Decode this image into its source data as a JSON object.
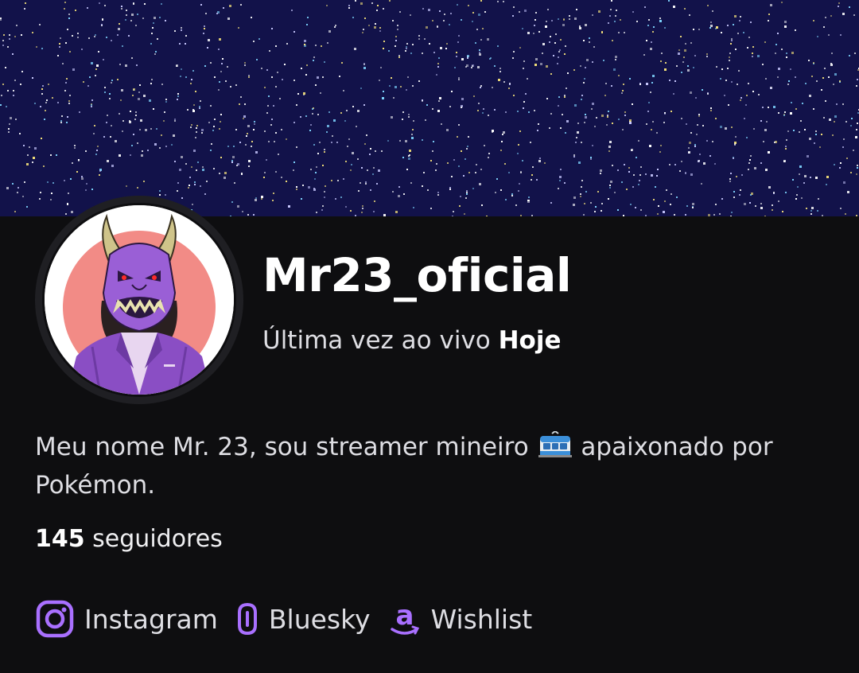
{
  "channel": {
    "name": "Mr23_oficial",
    "last_live_prefix": "Última vez ao vivo",
    "last_live_value": "Hoje"
  },
  "bio": {
    "before_emoji": "Meu nome Mr. 23, sou streamer mineiro",
    "emoji": "train-icon",
    "after_emoji": "apaixonado por Pokémon."
  },
  "followers": {
    "count": "145",
    "label": "seguidores"
  },
  "links": [
    {
      "label": "Instagram",
      "icon": "instagram-icon"
    },
    {
      "label": "Bluesky",
      "icon": "bluesky-icon"
    },
    {
      "label": "Wishlist",
      "icon": "amazon-icon"
    }
  ],
  "colors": {
    "background": "#0e0e10",
    "banner": "#12124a",
    "accent": "#a970ff",
    "avatar_circle": "#f28b86"
  }
}
